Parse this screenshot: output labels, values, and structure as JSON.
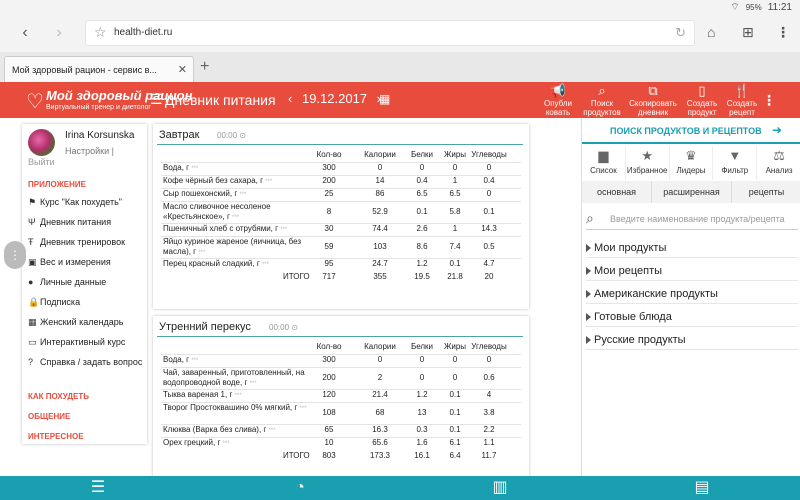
{
  "status_bar": {
    "battery": "95%",
    "time": "11:21"
  },
  "browser": {
    "url": "health-diet.ru",
    "tab_title": "Мой здоровый рацион - сервис в...",
    "new_tab": "+"
  },
  "app_header": {
    "logo_name": "Мой здоровый рацион",
    "logo_sub": "Виртуальный тренер и диетолог",
    "title": "Дневник питания",
    "date": "19.12.2017",
    "actions": [
      {
        "l1": "Опубли",
        "l2": "ковать"
      },
      {
        "l1": "Поиск",
        "l2": "продуктов"
      },
      {
        "l1": "Скопировать",
        "l2": "дневник"
      },
      {
        "l1": "Создать",
        "l2": "продукт"
      },
      {
        "l1": "Создать",
        "l2": "рецепт"
      }
    ]
  },
  "user": {
    "name": "Irina Korsunska",
    "settings": "Настройки |",
    "logout": "Выйти"
  },
  "sidebar": {
    "section_app": "ПРИЛОЖЕНИЕ",
    "items": [
      "Курс \"Как похудеть\"",
      "Дневник питания",
      "Дневник тренировок",
      "Вес и измерения",
      "Личные данные",
      "Подписка",
      "Женский календарь",
      "Интерактивный курс",
      "Справка / задать вопрос"
    ],
    "section_lose": "КАК ПОХУДЕТЬ",
    "section_social": "ОБЩЕНИЕ",
    "section_interesting": "ИНТЕРЕСНОЕ"
  },
  "columns": [
    "Кол-во",
    "Калории",
    "Белки",
    "Жиры",
    "Углеводы"
  ],
  "total_label": "ИТОГО",
  "stars": "***",
  "meals": [
    {
      "title": "Завтрак",
      "time": "00:00",
      "rows": [
        {
          "name": "Вода, г",
          "v": [
            "300",
            "0",
            "0",
            "0",
            "0"
          ]
        },
        {
          "name": "Кофе чёрный без сахара, г",
          "v": [
            "200",
            "14",
            "0.4",
            "1",
            "0.4"
          ]
        },
        {
          "name": "Сыр пошехонский, г",
          "v": [
            "25",
            "86",
            "6.5",
            "6.5",
            "0"
          ]
        },
        {
          "name": "Масло сливочное несоленое «Крестьянское», г",
          "v": [
            "8",
            "52.9",
            "0.1",
            "5.8",
            "0.1"
          ]
        },
        {
          "name": "Пшеничный хлеб с отрубями, г",
          "v": [
            "30",
            "74.4",
            "2.6",
            "1",
            "14.3"
          ]
        },
        {
          "name": "Яйцо куриное жареное (яичница, без масла), г",
          "v": [
            "59",
            "103",
            "8.6",
            "7.4",
            "0.5"
          ]
        },
        {
          "name": "Перец красный сладкий, г",
          "v": [
            "95",
            "24.7",
            "1.2",
            "0.1",
            "4.7"
          ]
        }
      ],
      "total": [
        "717",
        "355",
        "19.5",
        "21.8",
        "20"
      ]
    },
    {
      "title": "Утренний перекус",
      "time": "00:00",
      "rows": [
        {
          "name": "Вода, г",
          "v": [
            "300",
            "0",
            "0",
            "0",
            "0"
          ]
        },
        {
          "name": "Чай, заваренный, приготовленный, на водопроводной воде, г",
          "v": [
            "200",
            "2",
            "0",
            "0",
            "0.6"
          ]
        },
        {
          "name": "Тыква вареная 1, г",
          "v": [
            "120",
            "21.4",
            "1.2",
            "0.1",
            "4"
          ]
        },
        {
          "name": "Творог Простоквашино 0% мягкий, г",
          "v": [
            "108",
            "68",
            "13",
            "0.1",
            "3.8"
          ]
        },
        {
          "name": "Клюква (Варка без слива), г",
          "v": [
            "65",
            "16.3",
            "0.3",
            "0.1",
            "2.2"
          ]
        },
        {
          "name": "Орех грецкий, г",
          "v": [
            "10",
            "65.6",
            "1.6",
            "6.1",
            "1.1"
          ]
        }
      ],
      "total": [
        "803",
        "173.3",
        "16.1",
        "6.4",
        "11.7"
      ]
    }
  ],
  "right_panel": {
    "title": "ПОИСК ПРОДУКТОВ И РЕЦЕПТОВ",
    "tabs": [
      "Список",
      "Избранное",
      "Лидеры",
      "Фильтр",
      "Анализ"
    ],
    "subtabs": [
      "основная",
      "расширенная",
      "рецепты"
    ],
    "search_placeholder": "Введите наименование продукта/рецепта",
    "categories": [
      "Мои продукты",
      "Мои рецепты",
      "Американские продукты",
      "Готовые блюда",
      "Русские продукты"
    ]
  }
}
